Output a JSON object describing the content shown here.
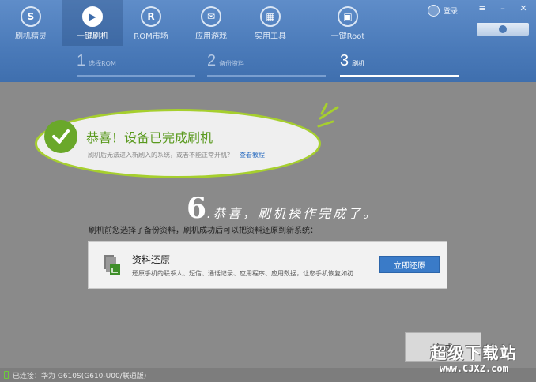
{
  "nav": {
    "items": [
      {
        "label": "刷机精灵",
        "icon": "shield-icon",
        "glyph": "S"
      },
      {
        "label": "一键刷机",
        "icon": "play-icon",
        "glyph": "▶"
      },
      {
        "label": "ROM市场",
        "icon": "rom-icon",
        "glyph": "R"
      },
      {
        "label": "应用游戏",
        "icon": "apps-icon",
        "glyph": "✉"
      },
      {
        "label": "实用工具",
        "icon": "tools-icon",
        "glyph": "▦"
      },
      {
        "label": "一键Root",
        "icon": "root-icon",
        "glyph": "▣"
      }
    ],
    "active_index": 1
  },
  "header": {
    "login_label": "登录",
    "menu_glyph": "≡",
    "minimize_glyph": "–",
    "close_glyph": "✕"
  },
  "steps": [
    {
      "num": "1",
      "label": "选择ROM"
    },
    {
      "num": "2",
      "label": "备份资料"
    },
    {
      "num": "3",
      "label": "刷机"
    }
  ],
  "result": {
    "title": "恭喜！设备已完成刷机",
    "subtitle": "刷机后无法进入新刷入的系统，或者不能正常开机？",
    "help_link": "查看教程"
  },
  "annotation": {
    "number": "6",
    "text": ".恭喜，刷机操作完成了。"
  },
  "backup": {
    "note": "刷机前您选择了备份资料，刷机成功后可以把资料还原到新系统：",
    "card_title": "资料还原",
    "card_desc": "还原手机的联系人、短信、通话记录、应用程序、应用数据，让您手机恢复如初",
    "restore_button": "立即还原"
  },
  "footer": {
    "finish_button": "完成",
    "status": "已连接：华为 G610S(G610-U00/联通版)"
  },
  "watermark": {
    "line1": "超级下载站",
    "line2": "www.CJXZ.com"
  },
  "colors": {
    "header_blue": "#4a7ab9",
    "success_green": "#6aa82a",
    "bubble_border": "#a6cf2e",
    "link_blue": "#2a6cc0",
    "button_blue": "#3a7bc8"
  }
}
